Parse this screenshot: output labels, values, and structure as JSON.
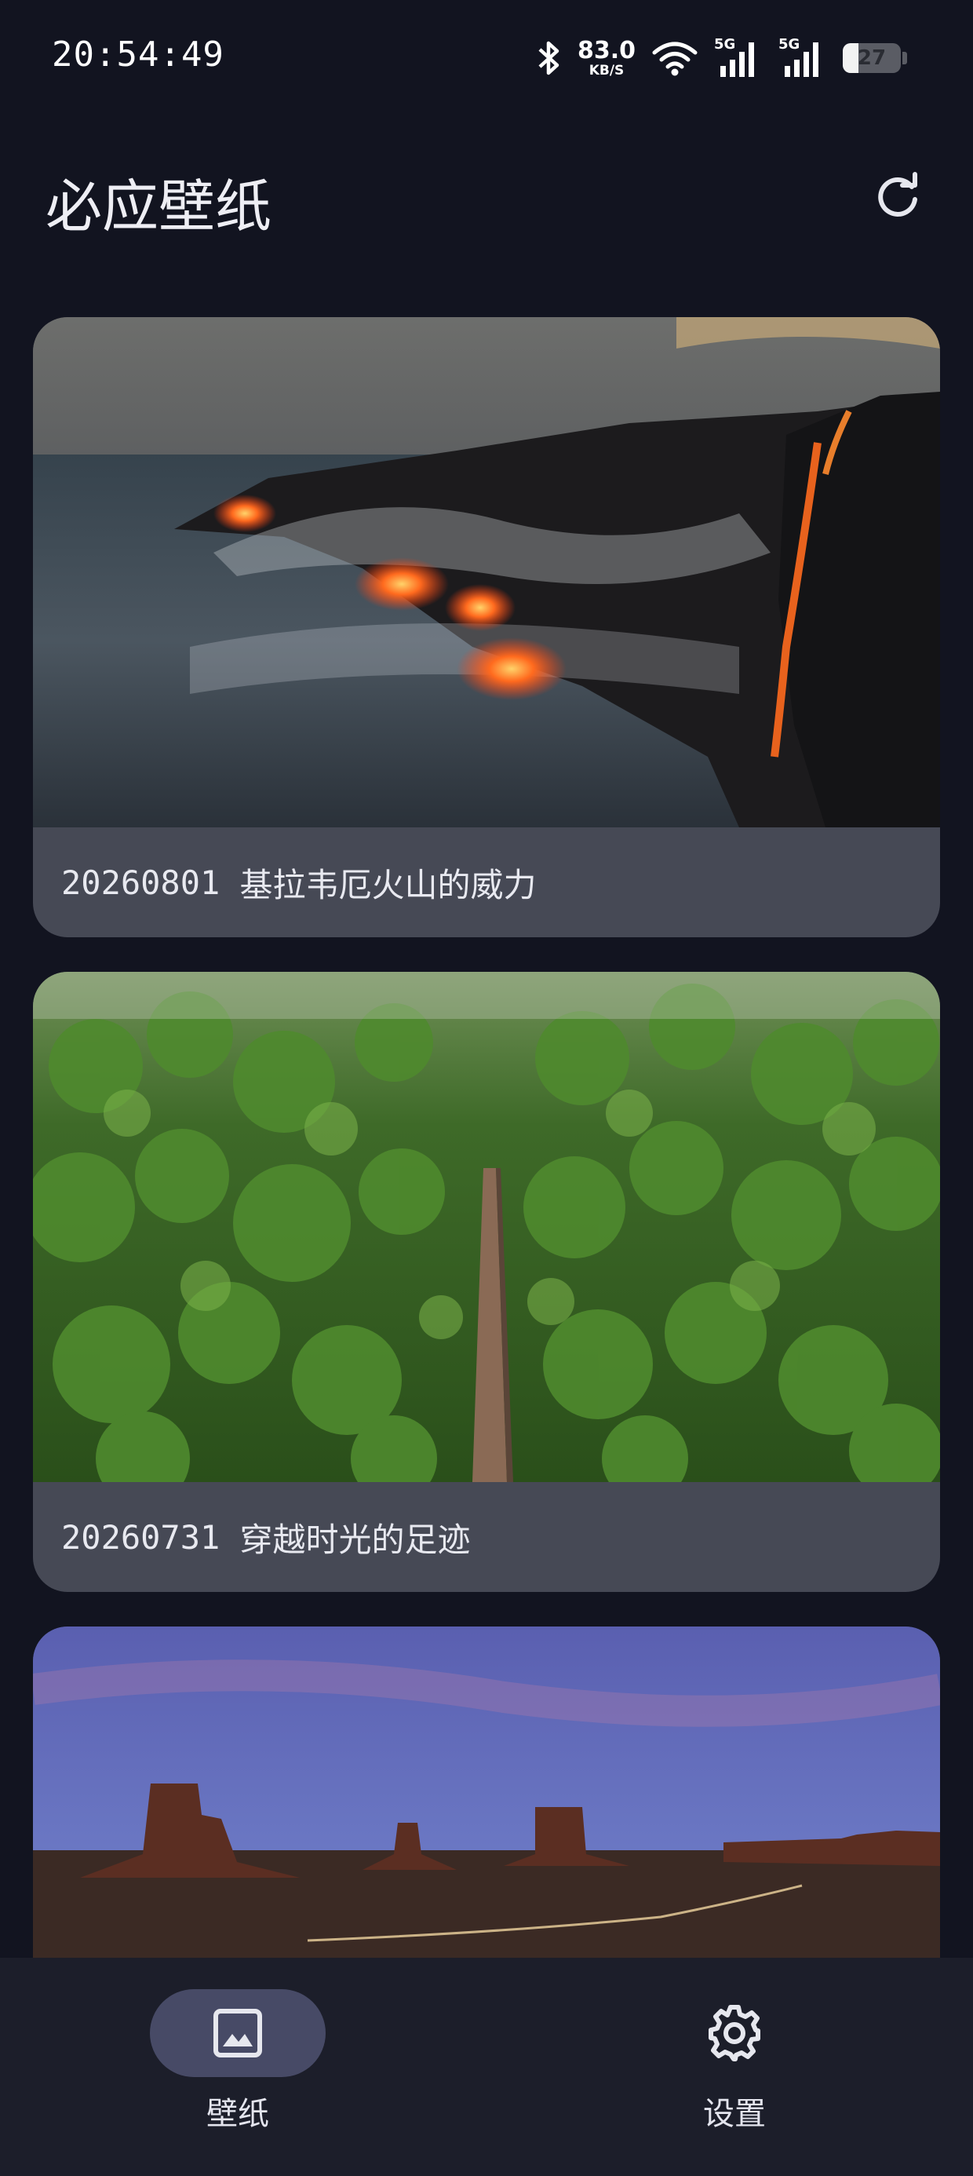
{
  "status_bar": {
    "time": "20:54:49",
    "net_speed_value": "83.0",
    "net_speed_unit": "KB/S",
    "signal_1_label": "5G",
    "signal_2_label": "5G",
    "battery_level": "27",
    "battery_fraction": 0.27,
    "icons": [
      "bluetooth-icon",
      "wifi-icon",
      "cell-signal-icon",
      "cell-signal-icon",
      "battery-icon"
    ]
  },
  "header": {
    "title": "必应壁纸",
    "refresh_icon": "refresh-icon"
  },
  "wallpapers": [
    {
      "date": "20260801",
      "title": "基拉韦厄火山的威力",
      "image": "lava flowing into ocean at dusk"
    },
    {
      "date": "20260731",
      "title": "穿越时光的足迹",
      "image": "aerial view of boardwalk through green forest"
    },
    {
      "date": "",
      "title": "",
      "image": "desert buttes under twilight sky"
    }
  ],
  "bottom_nav": {
    "items": [
      {
        "label": "壁纸",
        "icon": "image-icon",
        "active": true
      },
      {
        "label": "设置",
        "icon": "gear-icon",
        "active": false
      }
    ]
  },
  "colors": {
    "background": "#121420",
    "card": "#464955",
    "nav_background": "#1c1e2a",
    "nav_active_pill": "#474a66"
  }
}
